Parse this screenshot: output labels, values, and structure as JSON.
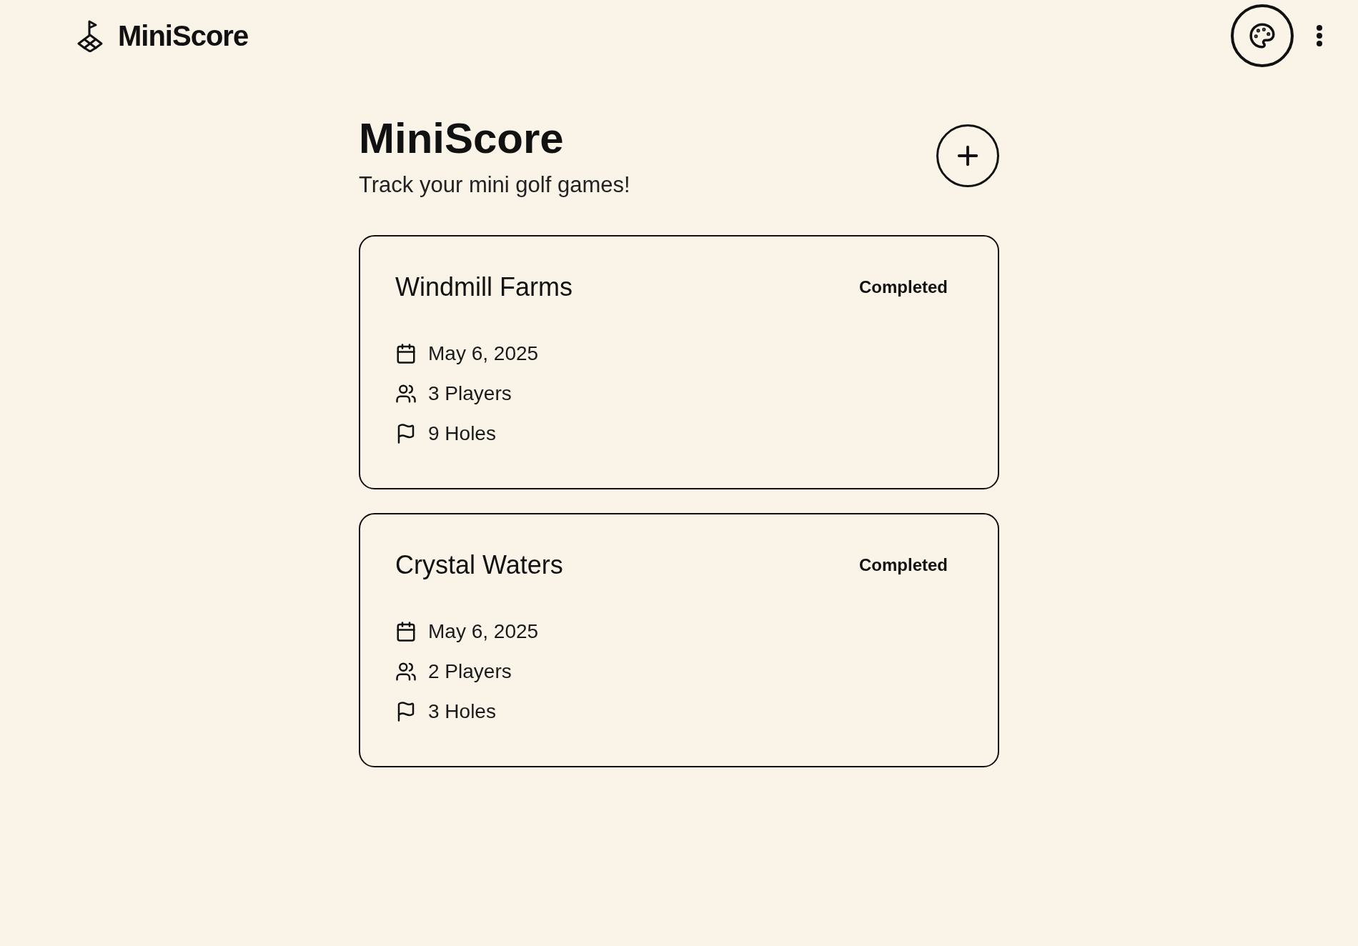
{
  "header": {
    "brand": "MiniScore"
  },
  "hero": {
    "title": "MiniScore",
    "subtitle": "Track your mini golf games!"
  },
  "games": [
    {
      "name": "Windmill Farms",
      "status": "Completed",
      "date": "May 6, 2025",
      "players": "3 Players",
      "holes": "9 Holes"
    },
    {
      "name": "Crystal Waters",
      "status": "Completed",
      "date": "May 6, 2025",
      "players": "2 Players",
      "holes": "3 Holes"
    }
  ]
}
